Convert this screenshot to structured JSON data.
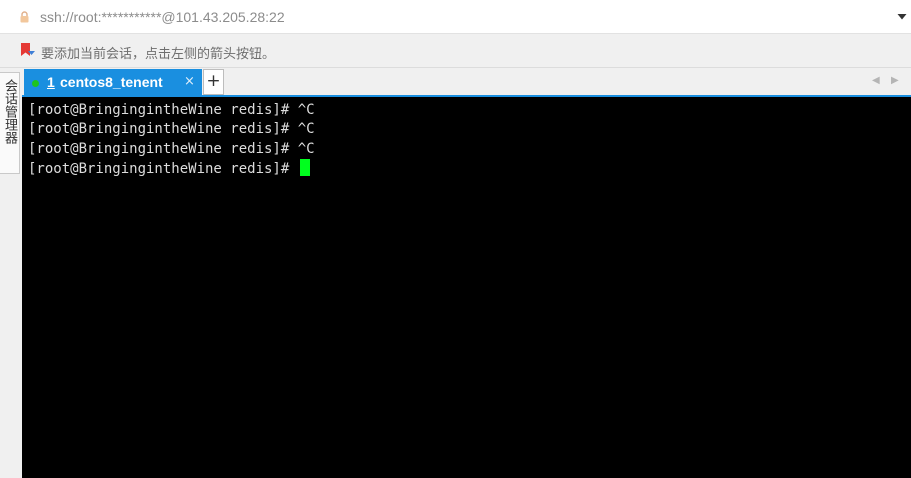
{
  "address_bar": {
    "text": "ssh://root:***********@101.43.205.28:22",
    "icons": [
      "lock-icon",
      "dropdown-arrow-icon"
    ]
  },
  "hint_bar": {
    "text": "要添加当前会话，点击左侧的箭头按钮。",
    "icon": "bookmark-flag-icon"
  },
  "side_panel": {
    "tab_label": "会话管理器"
  },
  "tabs": [
    {
      "number": "1",
      "title": "centos8_tenent",
      "status": "connected",
      "status_color": "#1ec41e",
      "active": true,
      "close_glyph": "×"
    }
  ],
  "tab_controls": {
    "add_glyph": "+",
    "prev_glyph": "◀",
    "next_glyph": "▶"
  },
  "colors": {
    "accent": "#1a8fe0",
    "terminal_bg": "#000000",
    "terminal_fg": "#dcdcdc",
    "cursor": "#00ff1e"
  },
  "terminal": {
    "lines": [
      "[root@BringingintheWine redis]# ^C",
      "[root@BringingintheWine redis]# ^C",
      "[root@BringingintheWine redis]# ^C",
      "[root@BringingintheWine redis]# "
    ]
  }
}
